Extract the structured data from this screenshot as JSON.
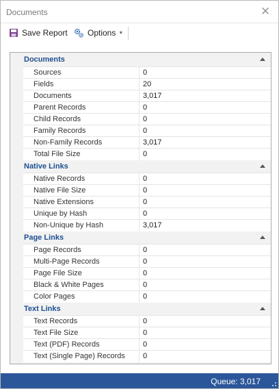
{
  "window": {
    "title": "Documents"
  },
  "toolbar": {
    "save_label": "Save Report",
    "options_label": "Options"
  },
  "sections": [
    {
      "label": "Documents",
      "rows": [
        {
          "name": "Sources",
          "value": "0"
        },
        {
          "name": "Fields",
          "value": "20"
        },
        {
          "name": "Documents",
          "value": "3,017"
        },
        {
          "name": "Parent Records",
          "value": "0"
        },
        {
          "name": "Child Records",
          "value": "0"
        },
        {
          "name": "Family Records",
          "value": "0"
        },
        {
          "name": "Non-Family Records",
          "value": "3,017"
        },
        {
          "name": "Total File Size",
          "value": "0"
        }
      ]
    },
    {
      "label": "Native Links",
      "rows": [
        {
          "name": "Native Records",
          "value": "0"
        },
        {
          "name": "Native File Size",
          "value": "0"
        },
        {
          "name": "Native Extensions",
          "value": "0"
        },
        {
          "name": "Unique by Hash",
          "value": "0"
        },
        {
          "name": "Non-Unique by Hash",
          "value": "3,017"
        }
      ]
    },
    {
      "label": "Page Links",
      "rows": [
        {
          "name": "Page Records",
          "value": "0"
        },
        {
          "name": "Multi-Page Records",
          "value": "0"
        },
        {
          "name": "Page File Size",
          "value": "0"
        },
        {
          "name": "Black & White Pages",
          "value": "0"
        },
        {
          "name": "Color Pages",
          "value": "0"
        }
      ]
    },
    {
      "label": "Text Links",
      "rows": [
        {
          "name": "Text Records",
          "value": "0"
        },
        {
          "name": "Text File Size",
          "value": "0"
        },
        {
          "name": "Text (PDF) Records",
          "value": "0"
        },
        {
          "name": "Text (Single Page) Records",
          "value": "0"
        }
      ]
    }
  ],
  "status": {
    "queue_text": "Queue: 3,017"
  },
  "colors": {
    "accent": "#2b579a",
    "category_text": "#1d4f91"
  }
}
